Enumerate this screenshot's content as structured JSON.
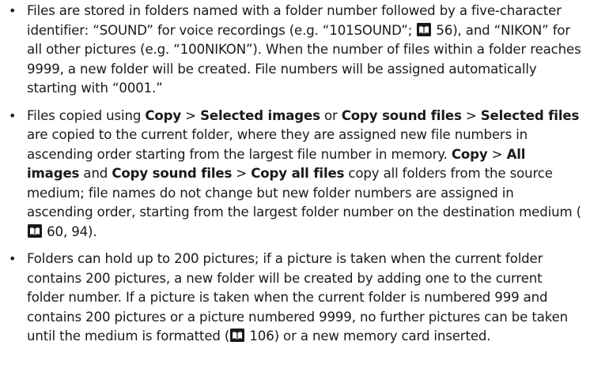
{
  "bullets": [
    {
      "segments": [
        {
          "t": "Files are stored in folders named with a folder number followed by a five-character identifier: “SOUND” for voice recordings (e.g. “101SOUND”; "
        },
        {
          "icon": "page-reference-icon"
        },
        {
          "t": " 56), and “NIKON” for all other pictures (e.g. “100NIKON”). When the number of files within a folder reaches 9999, a new folder will be created. File numbers will be assigned automatically starting with “0001.”"
        }
      ]
    },
    {
      "segments": [
        {
          "t": "Files copied using "
        },
        {
          "b": "Copy"
        },
        {
          "t": " > "
        },
        {
          "b": "Selected images"
        },
        {
          "t": " or "
        },
        {
          "b": "Copy sound files"
        },
        {
          "t": " > "
        },
        {
          "b": "Selected files"
        },
        {
          "t": " are copied to the current folder, where they are assigned new file numbers in ascending order starting from the largest file number in memory. "
        },
        {
          "b": "Copy"
        },
        {
          "t": " > "
        },
        {
          "b": "All images"
        },
        {
          "t": " and "
        },
        {
          "b": "Copy sound files"
        },
        {
          "t": " > "
        },
        {
          "b": "Copy all files"
        },
        {
          "t": " copy all folders from the source medium; file names do not change but new folder numbers are assigned in ascending order, starting from the largest folder number on the destination medium ("
        },
        {
          "icon": "page-reference-icon"
        },
        {
          "t": " 60, 94)."
        }
      ]
    },
    {
      "segments": [
        {
          "t": "Folders can hold up to 200 pictures; if a picture is taken when the current folder contains 200 pictures, a new folder will be created by adding one to the current folder number. If a picture is taken when the current folder is numbered 999 and contains 200 pictures or a picture numbered 9999, no further pictures can be taken until the medium is formatted ("
        },
        {
          "icon": "page-reference-icon"
        },
        {
          "t": " 106) or a new memory card inserted."
        }
      ]
    }
  ],
  "bullet_glyph": "•",
  "icon_color": "#1a1a1a"
}
